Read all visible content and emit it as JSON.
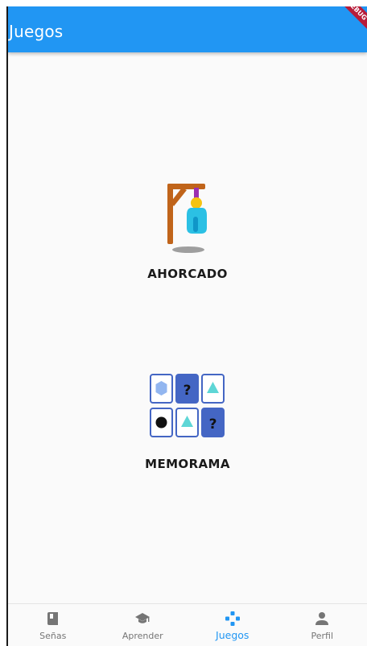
{
  "app": {
    "title": "Juegos",
    "debug_banner": "DEBUG"
  },
  "colors": {
    "primary": "#2196f3",
    "inactive": "#757575",
    "memorama_card": "#4466c4",
    "memorama_accent": "#5ed6d6"
  },
  "games": [
    {
      "label": "AHORCADO",
      "icon": "hangman-icon"
    },
    {
      "label": "MEMORAMA",
      "icon": "memory-cards-icon"
    }
  ],
  "bottom_nav": {
    "active_index": 2,
    "items": [
      {
        "label": "Señas",
        "icon": "book-icon"
      },
      {
        "label": "Aprender",
        "icon": "graduation-cap-icon"
      },
      {
        "label": "Juegos",
        "icon": "gamepad-icon"
      },
      {
        "label": "Perfil",
        "icon": "person-icon"
      }
    ]
  }
}
